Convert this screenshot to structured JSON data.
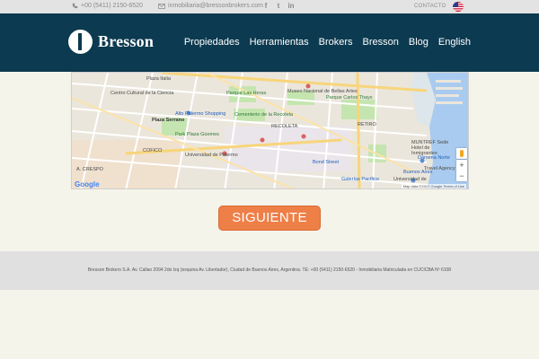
{
  "topbar": {
    "phone": "+00 (5411) 2150-6520",
    "email": "inmobiliaria@bressonbrokers.com",
    "social": [
      "facebook-icon",
      "twitter-icon",
      "linkedin-icon"
    ],
    "contact": "CONTACTO",
    "language_flag": "us-flag-icon"
  },
  "header": {
    "brand": "Bresson",
    "nav": [
      "Propiedades",
      "Herramientas",
      "Brokers",
      "Bresson",
      "Blog",
      "English"
    ]
  },
  "map": {
    "labels": [
      "Plaza Italia",
      "Centro Cultural de la Ciencia",
      "Parque Las Heras",
      "Museo Nacional de Bellas Artes",
      "Parque Carlos Thays",
      "Alto Palermo Shopping",
      "Cementerio de la Recoleta",
      "Plaza Serrano",
      "Park Plaza Güemes",
      "RECOLETA",
      "RETIRO",
      "COFICO",
      "Universidad de Palermo",
      "Bond Street",
      "A. CRESPO",
      "Galerías Pacífico",
      "Universidad de",
      "MUNTREF Sede Hotel de Inmigrantes",
      "Dársena Norte",
      "Travel Agency",
      "Buenos Aires"
    ],
    "google": "Google",
    "attribution": "Map data ©2017 Google   Terms of Use",
    "zoom_in": "+",
    "zoom_out": "−"
  },
  "button": {
    "label": "SIGUIENTE"
  },
  "footer": {
    "text": "Bresson Brokers S.A. Av. Callao 2094 2do Izq (esquina Av. Libertador), Ciudad de Buenos Aires, Argentina. TE: +00 (5411) 2150-6520 - Inmobiliaria Matriculada en CUCICBA Nº 6108"
  },
  "colors": {
    "header_bg": "#0c3a50",
    "accent": "#ee7f47",
    "water": "#a9cbef",
    "park": "#c5e5b0"
  }
}
